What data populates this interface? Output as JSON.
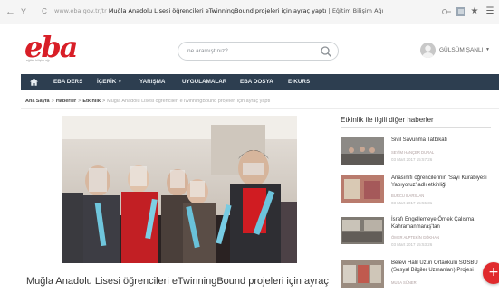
{
  "browser": {
    "url_domain": "www.eba.gov.tr",
    "url_title": "Muğla Anadolu Lisesi öğrencileri eTwinningBound projeleri için ayraç yaptı",
    "url_suffix": "| Eğitim Bilişim Ağı"
  },
  "logo": {
    "text": "eba",
    "subtitle": "eğitim bilişim ağı"
  },
  "search": {
    "placeholder": "ne aramıştınız?"
  },
  "user": {
    "name": "GÜLSÜM ŞANLI"
  },
  "nav": {
    "items": [
      {
        "label": "EBA DERS"
      },
      {
        "label": "İÇERİK"
      },
      {
        "label": "YARIŞMA"
      },
      {
        "label": "UYGULAMALAR"
      },
      {
        "label": "EBA DOSYA"
      },
      {
        "label": "E-KURS"
      }
    ],
    "color": "#2d3e50"
  },
  "breadcrumb": {
    "home": "Ana Sayfa",
    "news": "Haberler",
    "category": "Etkinlik",
    "current": "Muğla Anadolu Lisesi öğrencileri eTwinningBound projeleri için ayraç yaptı"
  },
  "article": {
    "title": "Muğla Anadolu Lisesi öğrencileri eTwinningBound projeleri için ayraç"
  },
  "sidebar": {
    "title": "Etkinlik ile ilgili diğer haberler",
    "news": [
      {
        "title": "Sivil Savunma Tatbikatı",
        "author": "SEVİM HANÇER DURAL",
        "date": "03 Mart 2017 15:57:26"
      },
      {
        "title": "Anasınıfı öğrencilerinin 'Sayı Kurabiyesi Yapıyoruz' adlı etkinliği",
        "author": "BURCU İLARSLAN",
        "date": "03 Mart 2017 15:55:31"
      },
      {
        "title": "İsrafı Engellemeye Örnek Çalışma Kahramanmaraş'tan",
        "author": "ÖMER ALPTEKİN GÖKHAN",
        "date": "03 Mart 2017 15:53:26"
      },
      {
        "title": "Belevi Halil Uzun Ortaokulu SOSBU (Sosyal Bilgiler Uzmanları) Projesi",
        "author": "MUSA SÜNER",
        "date": ""
      }
    ]
  },
  "colors": {
    "brand": "#d81e27",
    "fab": "#e02a2d"
  },
  "fab": {
    "label": "+"
  }
}
